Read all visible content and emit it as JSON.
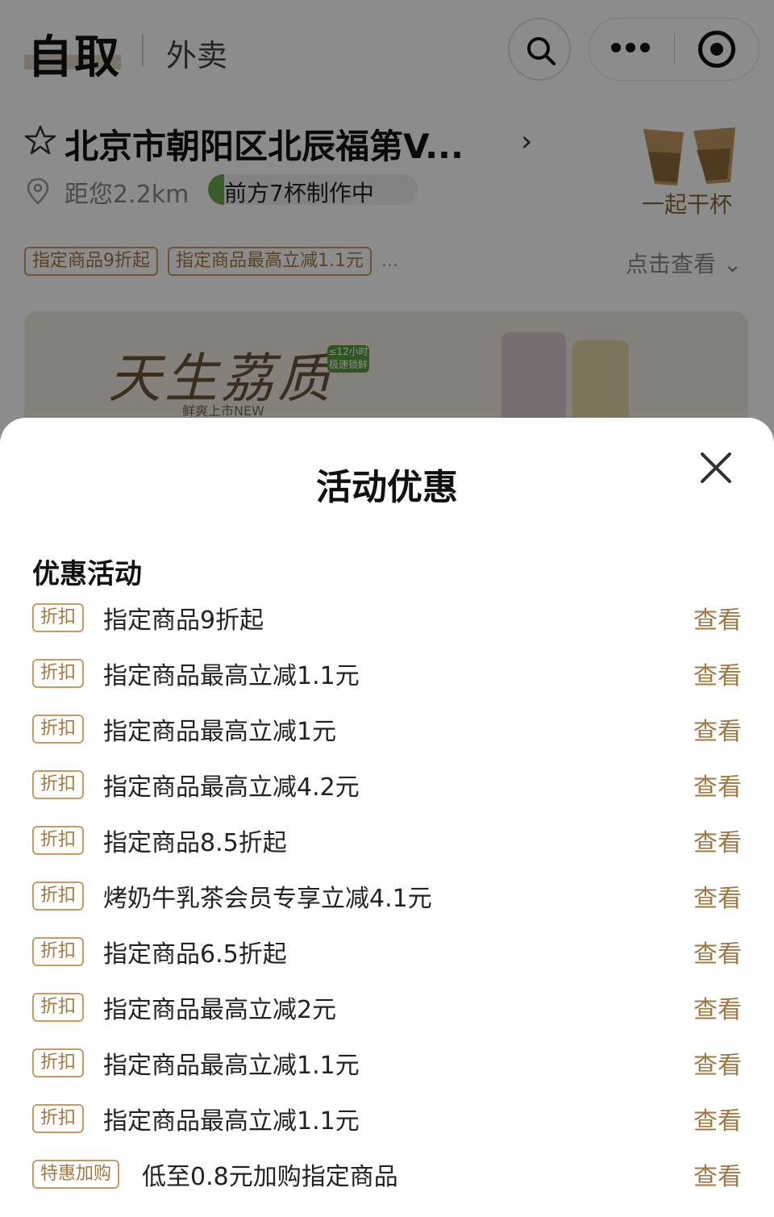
{
  "header": {
    "tab_pickup": "自取",
    "tab_delivery": "外卖"
  },
  "store": {
    "name": "北京市朝阳区北辰福第V...",
    "distance": "距您2.2km",
    "queue": "前方7杯制作中",
    "cheers_label": "一起干杯"
  },
  "promo_tags": [
    "指定商品9折起",
    "指定商品最高立减1.1元"
  ],
  "promo_tags_more": "...",
  "see_more": "点击查看",
  "banner": {
    "title": "天生荔质",
    "badge": "≤12小时 极速锁鲜",
    "subtitle": "鲜爽上市NEW"
  },
  "sheet": {
    "title": "活动优惠",
    "section_title": "优惠活动",
    "items": [
      {
        "badge": "折扣",
        "text": "指定商品9折起",
        "action": "查看"
      },
      {
        "badge": "折扣",
        "text": "指定商品最高立减1.1元",
        "action": "查看"
      },
      {
        "badge": "折扣",
        "text": "指定商品最高立减1元",
        "action": "查看"
      },
      {
        "badge": "折扣",
        "text": "指定商品最高立减4.2元",
        "action": "查看"
      },
      {
        "badge": "折扣",
        "text": "指定商品8.5折起",
        "action": "查看"
      },
      {
        "badge": "折扣",
        "text": "烤奶牛乳茶会员专享立减4.1元",
        "action": "查看"
      },
      {
        "badge": "折扣",
        "text": "指定商品6.5折起",
        "action": "查看"
      },
      {
        "badge": "折扣",
        "text": "指定商品最高立减2元",
        "action": "查看"
      },
      {
        "badge": "折扣",
        "text": "指定商品最高立减1.1元",
        "action": "查看"
      },
      {
        "badge": "折扣",
        "text": "指定商品最高立减1.1元",
        "action": "查看"
      },
      {
        "badge": "特惠加购",
        "text": "低至0.8元加购指定商品",
        "action": "查看"
      }
    ]
  },
  "colors": {
    "accent": "#a27842",
    "badge_border": "#c99b63",
    "overlay": "rgba(0,0,0,0.45)"
  }
}
